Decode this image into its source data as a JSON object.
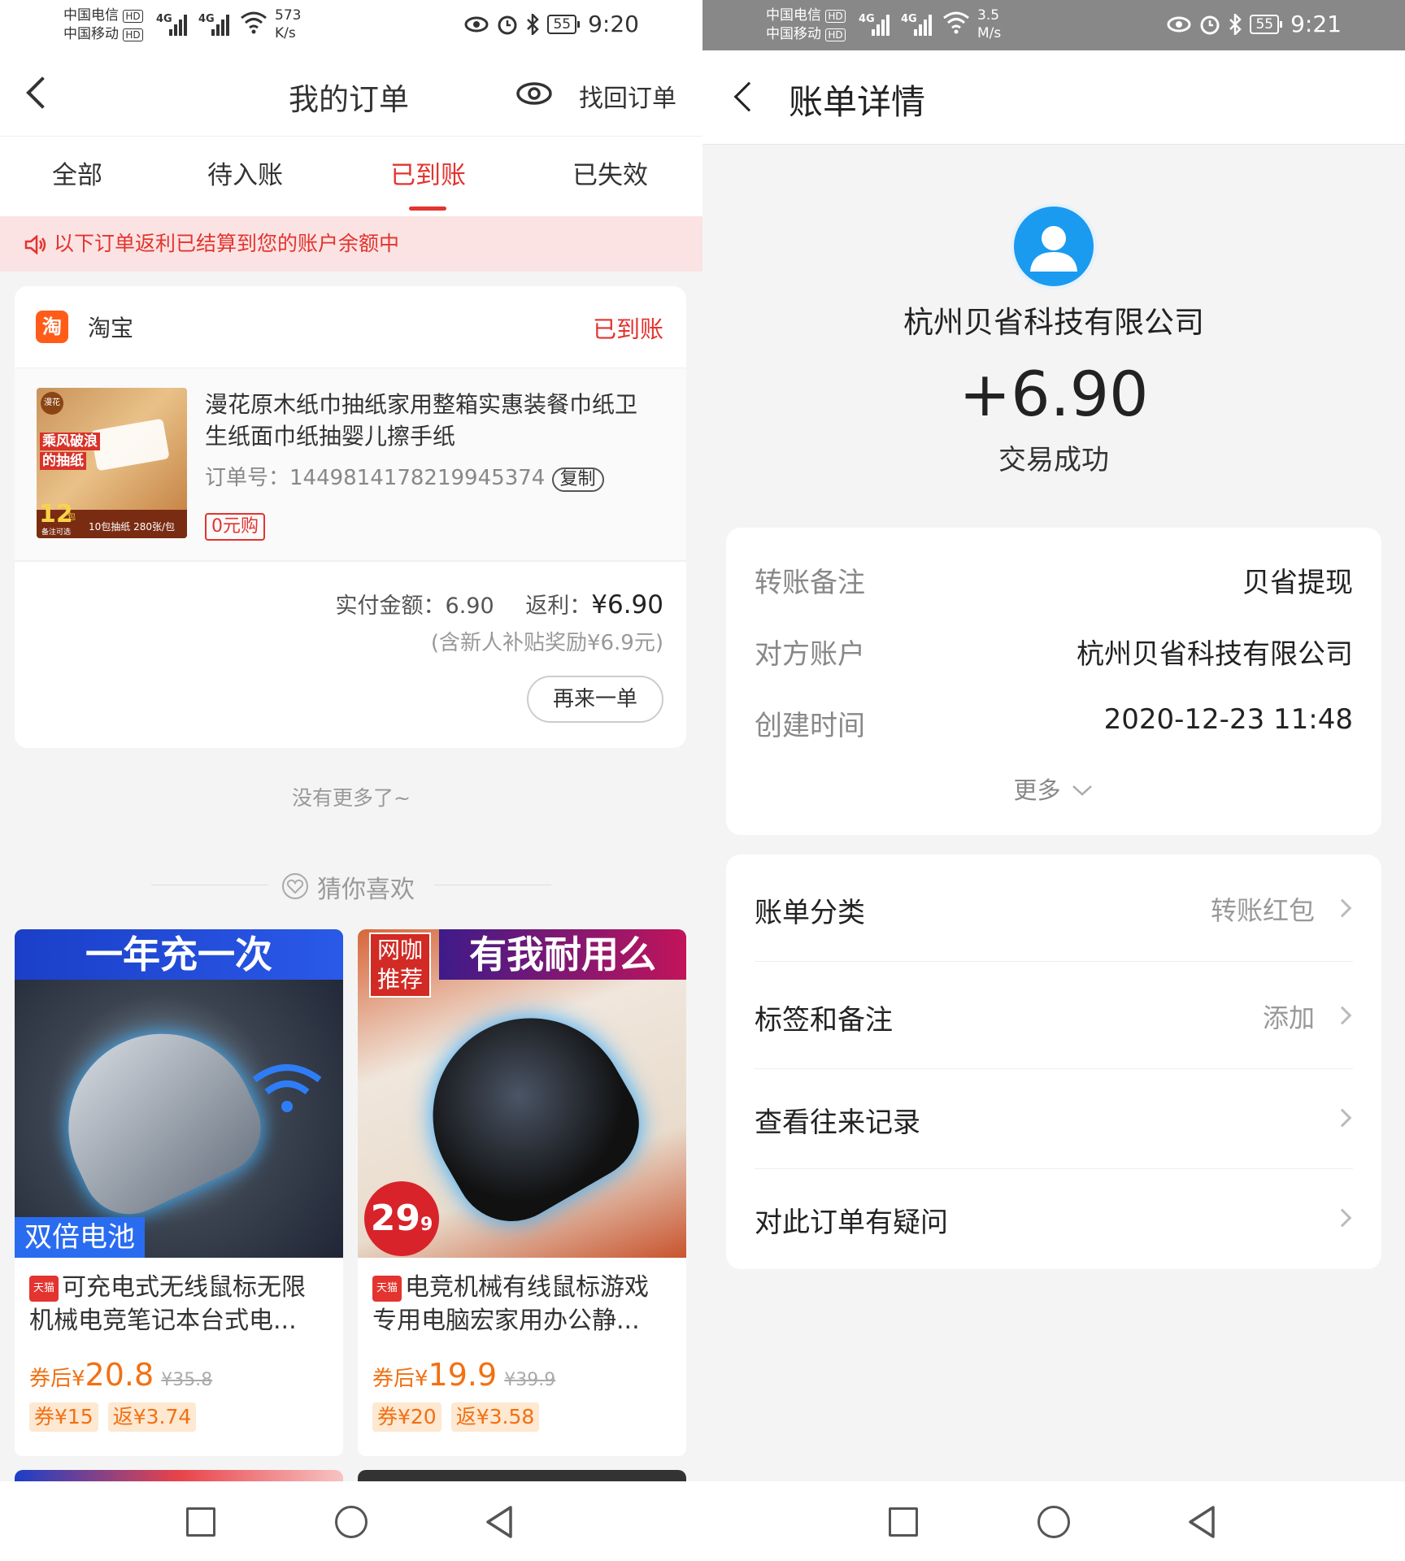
{
  "left": {
    "status": {
      "carrier1": "中国电信",
      "carrier2": "中国移动",
      "hd": "HD",
      "net": "4G",
      "speed_value": "573",
      "speed_unit": "K/s",
      "battery": "55",
      "time": "9:20"
    },
    "header": {
      "title": "我的订单",
      "retrieve": "找回订单"
    },
    "tabs": [
      "全部",
      "待入账",
      "已到账",
      "已失效"
    ],
    "active_tab": 2,
    "notice": "以下订单返利已结算到您的账户余额中",
    "order": {
      "shop_logo": "淘",
      "shop": "淘宝",
      "status": "已到账",
      "title_line1": "漫花原木纸巾抽纸家用整箱实惠装餐巾纸卫",
      "title_line2": "生纸面巾纸抽婴儿擦手纸",
      "order_no_label": "订单号：",
      "order_no": "1449814178219945374",
      "copy": "复制",
      "badge": "0元购",
      "paid_label": "实付金额：",
      "paid": "6.90",
      "rebate_label": "返利：",
      "rebate": "¥6.90",
      "note": "(含新人补贴奖励¥6.9元)",
      "rebuy": "再来一单",
      "image_text": {
        "brand": "漫花",
        "slogan1": "乘风破浪",
        "slogan2": "的抽纸",
        "count": "12",
        "unit": "包",
        "sub": "备注可选",
        "pack": "10包抽纸 280张/包"
      }
    },
    "no_more": "没有更多了~",
    "guess": "猜你喜欢",
    "products": [
      {
        "banner": "一年充一次",
        "badge": "双倍电池",
        "tag": "天猫",
        "title1": "可充电式无线鼠标无限",
        "title2": "机械电竞笔记本台式电...",
        "price_prefix": "券后¥",
        "price": "20.8",
        "orig": "¥35.8",
        "coupon": "券¥15",
        "rebate": "返¥3.74"
      },
      {
        "banner": "有我耐用么",
        "corner1": "网咖",
        "corner2": "推荐",
        "price_tag": "29",
        "price_tag_dec": "9",
        "tag": "天猫",
        "title1": "电竞机械有线鼠标游戏",
        "title2": "专用电脑宏家用办公静...",
        "price_prefix": "券后¥",
        "price": "19.9",
        "orig": "¥39.9",
        "coupon": "券¥20",
        "rebate": "返¥3.58"
      }
    ]
  },
  "right": {
    "status": {
      "carrier1": "中国电信",
      "carrier2": "中国移动",
      "hd": "HD",
      "net": "4G",
      "speed_value": "3.5",
      "speed_unit": "M/s",
      "battery": "55",
      "time": "9:21"
    },
    "header": {
      "title": "账单详情"
    },
    "payee": "杭州贝省科技有限公司",
    "amount": "+6.90",
    "result": "交易成功",
    "details": [
      {
        "label": "转账备注",
        "value": "贝省提现"
      },
      {
        "label": "对方账户",
        "value": "杭州贝省科技有限公司"
      },
      {
        "label": "创建时间",
        "value": "2020-12-23 11:48"
      }
    ],
    "more": "更多",
    "menu": [
      {
        "label": "账单分类",
        "value": "转账红包"
      },
      {
        "label": "标签和备注",
        "value": "添加"
      },
      {
        "label": "查看往来记录",
        "value": ""
      },
      {
        "label": "对此订单有疑问",
        "value": ""
      }
    ]
  },
  "colors": {
    "accent": "#e3342f",
    "orange": "#f27012",
    "blue": "#1a9bf0"
  }
}
